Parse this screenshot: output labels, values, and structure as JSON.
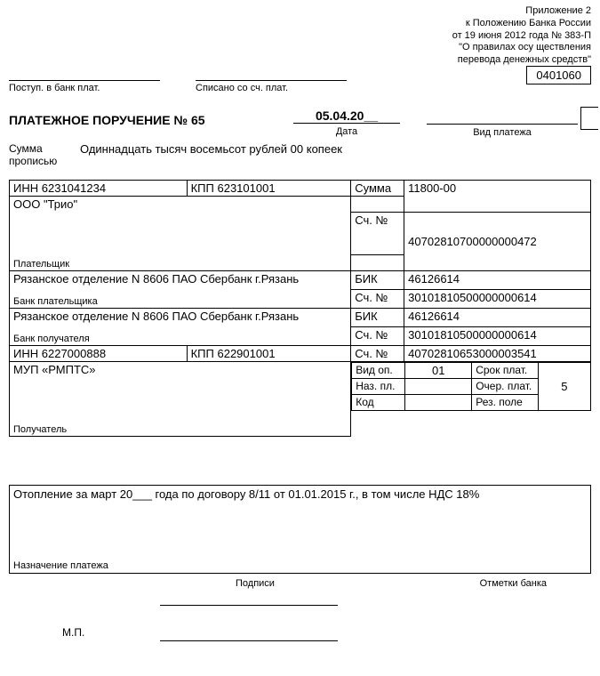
{
  "header": {
    "appendix": "Приложение 2",
    "line2": "к Положению Банка России",
    "line3": "от 19 июня 2012 года № 383-П",
    "line4": "\"О правилах осу ществления",
    "line5": "перевода денежных средств\"",
    "form_code": "0401060"
  },
  "stamps": {
    "incoming": "Поступ. в банк плат.",
    "writeoff": "Списано со сч. плат."
  },
  "title": {
    "label": "ПЛАТЕЖНОЕ ПОРУЧЕНИЕ №",
    "number": "65",
    "date_value": "05.04.20__",
    "date_label": "Дата",
    "paytype_label": "Вид платежа"
  },
  "amount_words": {
    "label": "Сумма прописью",
    "value": "Одиннадцать тысяч восемьсот рублей 00 копеек"
  },
  "labels": {
    "inn": "ИНН",
    "kpp": "КПП",
    "summa": "Сумма",
    "sch_no": "Сч. №",
    "payer": "Плательщик",
    "bik": "БИК",
    "payer_bank": "Банк плательщика",
    "payee_bank": "Банк получателя",
    "payee": "Получатель",
    "vid_op": "Вид оп.",
    "naz_pl": "Наз. пл.",
    "kod": "Код",
    "srok": "Срок плат.",
    "ocher": "Очер. плат.",
    "rez": "Рез. поле",
    "purpose": "Назначение платежа",
    "podpisi": "Подписи",
    "otmetki": "Отметки банка",
    "mp": "М.П."
  },
  "payer": {
    "inn": "6231041234",
    "kpp": "623101001",
    "name": "ООО \"Трио\"",
    "account": "40702810700000000472",
    "bank_name": "Рязанское отделение N 8606 ПАО Сбербанк г.Рязань",
    "bik": "46126614",
    "bank_account": "30101810500000000614"
  },
  "payee": {
    "bank_name": "Рязанское отделение N 8606 ПАО Сбербанк г.Рязань",
    "bik": "46126614",
    "bank_account": "30101810500000000614",
    "inn": "6227000888",
    "kpp": "622901001",
    "account": "40702810653000003541",
    "name": "МУП «РМПТС»"
  },
  "summa": "11800-00",
  "ops": {
    "vid_op": "01",
    "ocher": "5"
  },
  "purpose": "Отопление за март 20___ года по договору 8/11 от 01.01.2015 г., в том числе НДС 18%"
}
